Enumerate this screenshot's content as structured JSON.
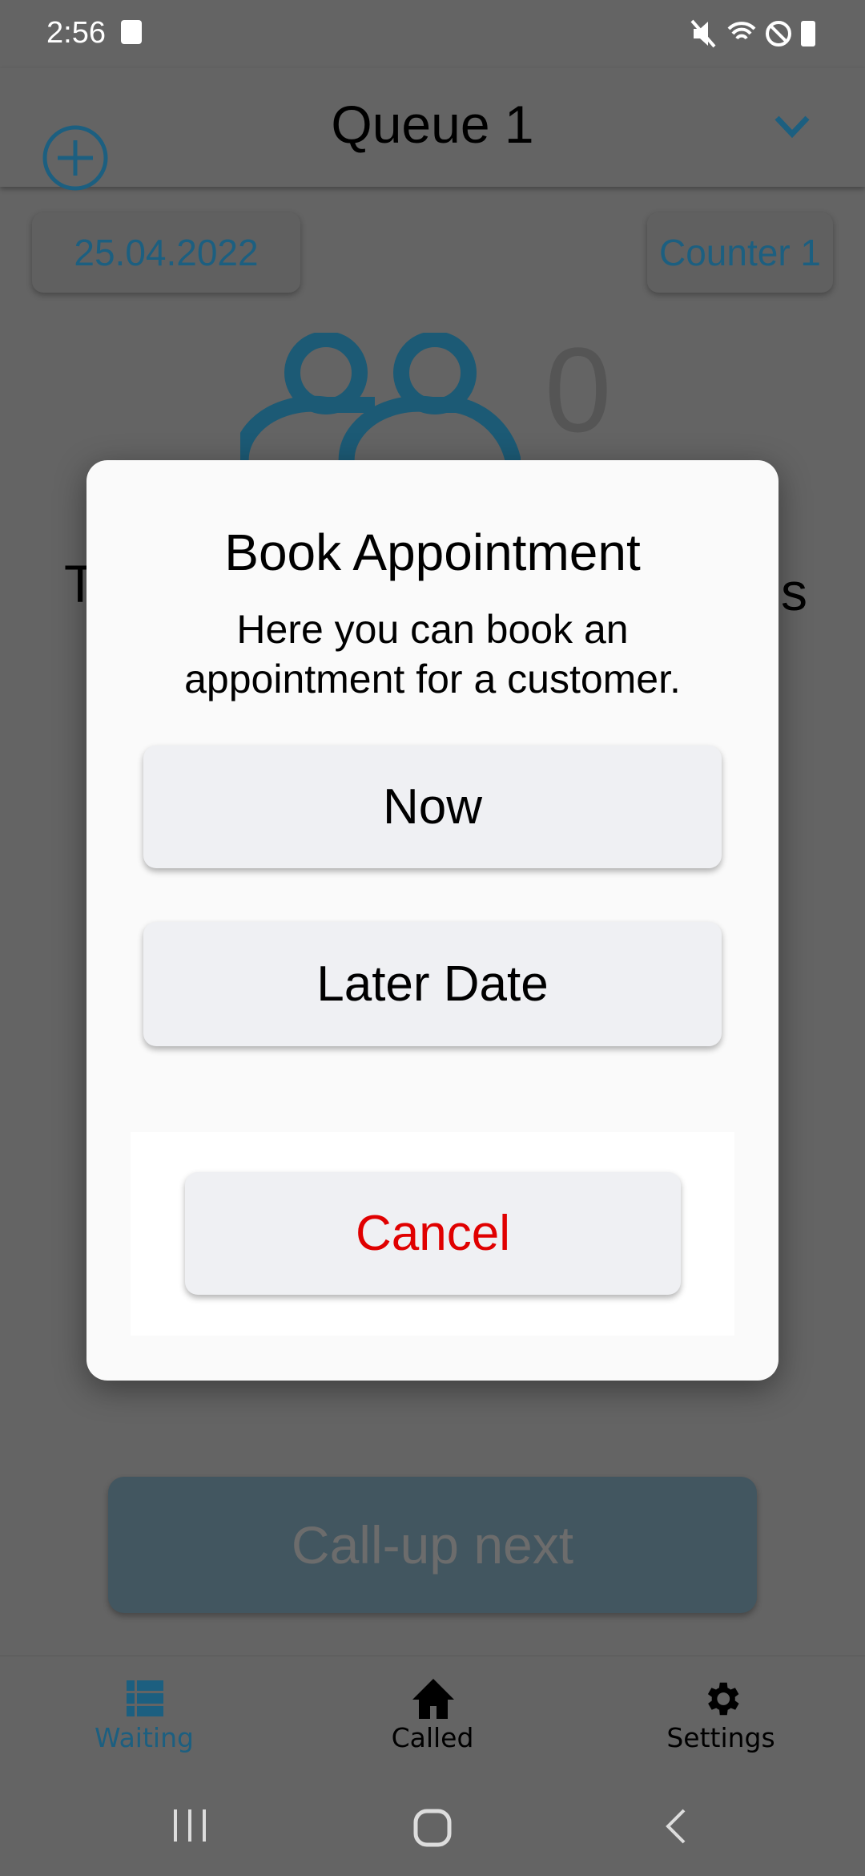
{
  "status_bar": {
    "time": "2:56",
    "icons": [
      "photo-icon",
      "mute-icon",
      "wifi-icon",
      "do-not-disturb-icon",
      "battery-icon"
    ]
  },
  "app_bar": {
    "title": "Queue 1",
    "add_icon": "plus-circle-icon",
    "dropdown_icon": "chevron-down-icon"
  },
  "date_chip": "25.04.2022",
  "counter_chip": "Counter 1",
  "waiting_count": "0",
  "background_text": {
    "left_fragment": "T",
    "right_fragment": "s"
  },
  "call_next_label": "Call-up next",
  "bottom_nav": {
    "items": [
      {
        "label": "Waiting",
        "icon": "list-icon",
        "active": true
      },
      {
        "label": "Called",
        "icon": "home-icon",
        "active": false
      },
      {
        "label": "Settings",
        "icon": "gear-icon",
        "active": false
      }
    ]
  },
  "dialog": {
    "title": "Book Appointment",
    "message_line1": "Here you can book an",
    "message_line2": "appointment for a customer.",
    "now_label": "Now",
    "later_label": "Later Date",
    "cancel_label": "Cancel"
  },
  "colors": {
    "accent": "#2a8fbf",
    "cancel": "#e00000",
    "overlay": "rgba(0,0,0,0.6)"
  }
}
